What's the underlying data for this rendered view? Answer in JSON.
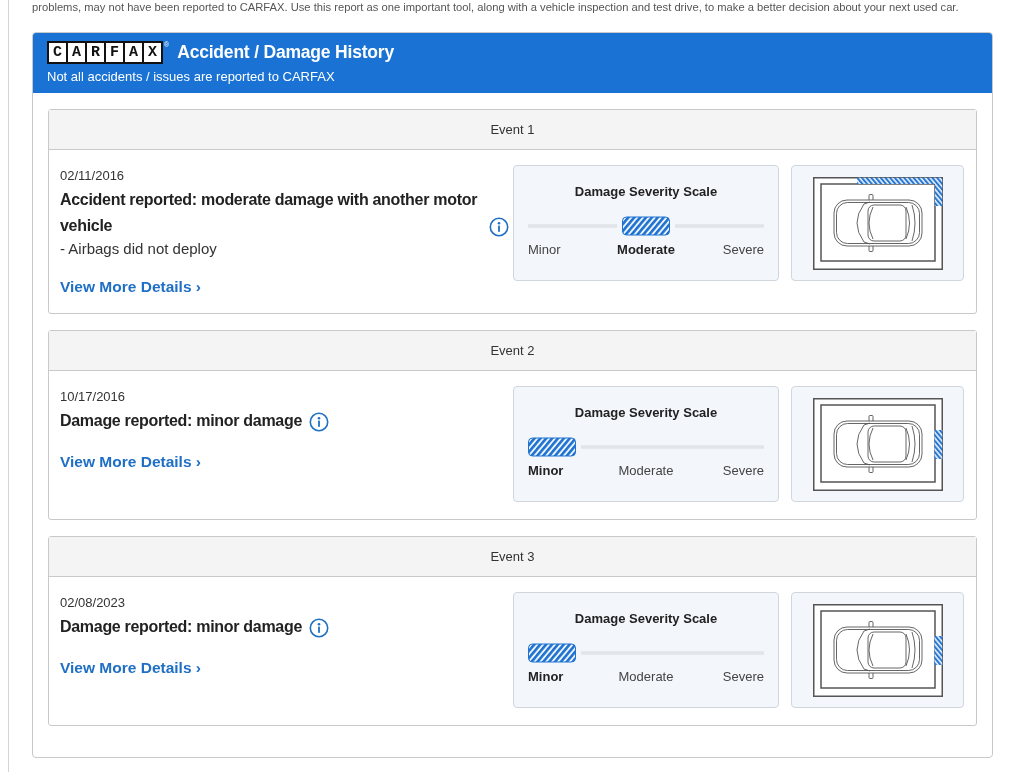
{
  "intro_text": "problems, may not have been reported to CARFAX. Use this report as one important tool, along with a vehicle inspection and test drive, to make a better decision about your next used car.",
  "header": {
    "logo": "CARFAX",
    "logo_mark": "®",
    "title": "Accident / Damage History",
    "subtitle": "Not all accidents / issues are reported to CARFAX"
  },
  "events": [
    {
      "heading": "Event 1",
      "date": "02/11/2016",
      "title": "Accident reported: moderate damage with another motor vehicle",
      "details": [
        "- Airbags did not deploy"
      ],
      "link": "View More Details ›",
      "severity": {
        "title": "Damage Severity Scale",
        "levels": [
          {
            "label": "Minor",
            "selected": false
          },
          {
            "label": "Moderate",
            "selected": true
          },
          {
            "label": "Severe",
            "selected": false
          }
        ]
      },
      "damage_area": {
        "kind": "corner"
      }
    },
    {
      "heading": "Event 2",
      "date": "10/17/2016",
      "title": "Damage reported: minor damage",
      "link": "View More Details ›",
      "severity": {
        "title": "Damage Severity Scale",
        "levels": [
          {
            "label": "Minor",
            "selected": true
          },
          {
            "label": "Moderate",
            "selected": false
          },
          {
            "label": "Severe",
            "selected": false
          }
        ]
      },
      "damage_area": {
        "kind": "side"
      }
    },
    {
      "heading": "Event 3",
      "date": "02/08/2023",
      "title": "Damage reported: minor damage",
      "link": "View More Details ›",
      "severity": {
        "title": "Damage Severity Scale",
        "levels": [
          {
            "label": "Minor",
            "selected": true
          },
          {
            "label": "Moderate",
            "selected": false
          },
          {
            "label": "Severe",
            "selected": false
          }
        ]
      },
      "damage_area": {
        "kind": "side"
      }
    }
  ]
}
